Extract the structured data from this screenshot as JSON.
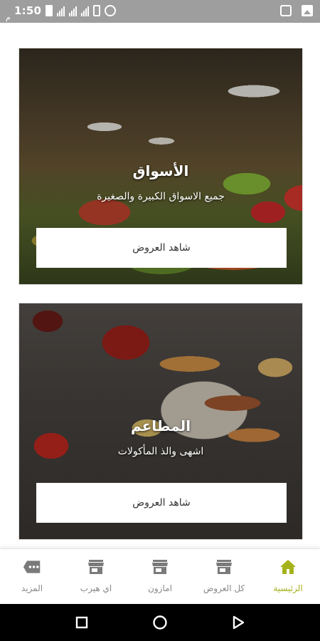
{
  "status_bar": {
    "time": "1:50",
    "ampm": "م"
  },
  "cards": [
    {
      "title": "الأسواق",
      "subtitle": "جميع الاسواق الكبيرة والصغيرة",
      "button": "شاهد العروض"
    },
    {
      "title": "المطاعم",
      "subtitle": "اشهى والذ المأكولات",
      "button": "شاهد العروض"
    }
  ],
  "bottom_nav": {
    "active_color": "#a6b21a",
    "inactive_color": "#7a7a7a",
    "items": [
      {
        "label": "الرئيسية",
        "icon": "home-icon",
        "active": true
      },
      {
        "label": "كل العروض",
        "icon": "store-icon",
        "active": false
      },
      {
        "label": "امازون",
        "icon": "store-icon",
        "active": false
      },
      {
        "label": "اي هيرب",
        "icon": "store-icon",
        "active": false
      },
      {
        "label": "المزيد",
        "icon": "more-icon",
        "active": false
      }
    ]
  }
}
